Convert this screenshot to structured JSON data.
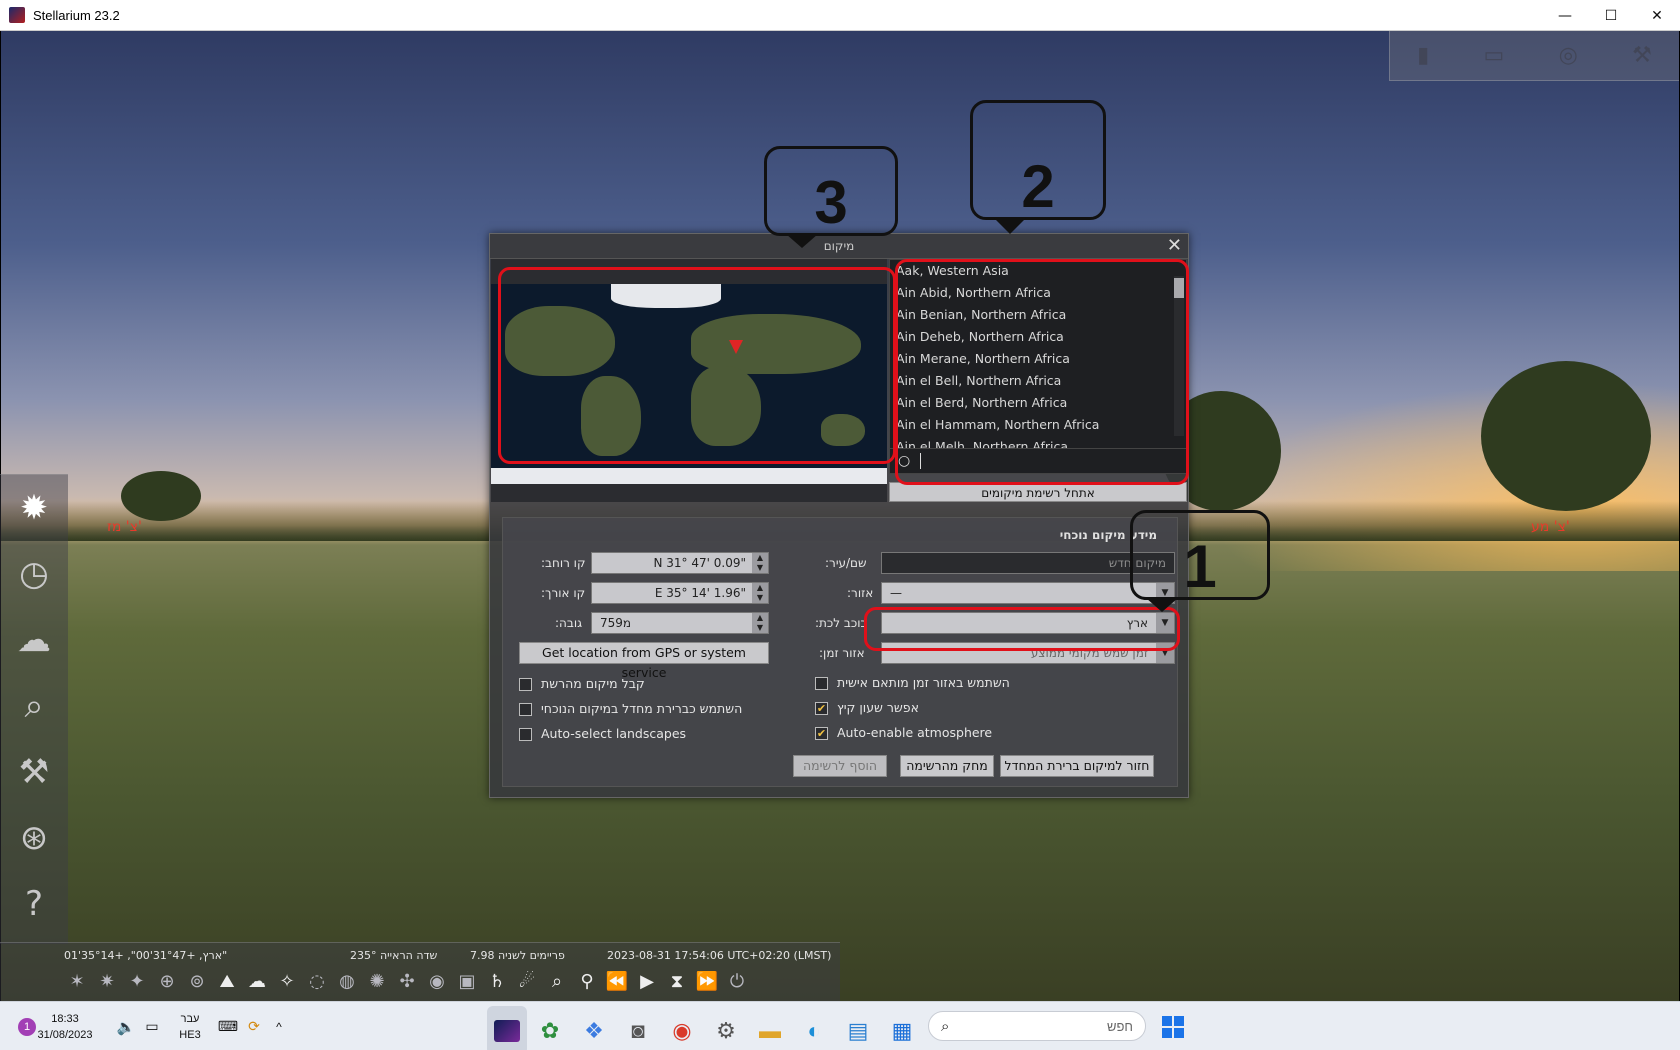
{
  "window": {
    "title": "Stellarium 23.2",
    "minimize": "—",
    "maximize": "☐",
    "close": "✕"
  },
  "scene": {
    "cardinal_left": "צ' מז'",
    "cardinal_right": "צ' מע'"
  },
  "dialog": {
    "title": "מיקום",
    "close": "✕",
    "city_list": [
      "Aak, Western Asia",
      "Ain Abid, Northern Africa",
      "Ain Benian, Northern Africa",
      "Ain Deheb, Northern Africa",
      "Ain Merane, Northern Africa",
      "Ain el Bell, Northern Africa",
      "Ain el Berd, Northern Africa",
      "Ain el Hammam, Northern Africa",
      "Ain el Melh, Northern Africa"
    ],
    "reset_list_button": "אתחל רשימת מיקומים",
    "section_title": "מידע מיקום נוכחי",
    "latitude_label": "קו רוחב:",
    "latitude_value": "N 31° 47' 0.09\"",
    "longitude_label": "קו אורך:",
    "longitude_value": "E 35° 14' 1.96\"",
    "altitude_label": "גובה:",
    "altitude_value": "759מ",
    "name_label": "שם/עיר:",
    "name_placeholder": "מיקום חדש",
    "region_label": "אזור:",
    "region_value": "—",
    "planet_label": "כוכב לכת:",
    "planet_value": "ארץ",
    "timezone_label": "אזור זמן:",
    "timezone_value": "זמן שמש מקומי ממוצע",
    "gps_button": "Get location from GPS or system service",
    "cb_network_location": "קבל מיקום מהרשת",
    "cb_use_default": "השתמש כברירת מחדל במיקום הנוכחי",
    "cb_auto_landscape": "Auto-select landscapes",
    "cb_custom_tz": "השתמש באזור זמן מותאם אישית",
    "cb_dst": "אפשר שעון קיץ",
    "cb_auto_atmosphere": "Auto-enable atmosphere",
    "add_button": "הוסף לרשימה",
    "delete_button": "מחק מהרשימה",
    "return_default_button": "חזור למיקום ברירת המחדל"
  },
  "annotations": {
    "bubble_1": "1",
    "bubble_2": "2",
    "bubble_3": "3"
  },
  "status": {
    "location": "ארץ, +31°47'00\", +35°14'01\"",
    "fov": "שדה הראייה 235°",
    "fps": "7.98 פריימים לשניה",
    "datetime": "2023-08-31 17:54:06 UTC+02:20 (LMST)"
  },
  "taskbar": {
    "time": "18:33",
    "date": "31/08/2023",
    "lang_top": "עבר",
    "lang_bottom": "HE3",
    "notification_count": "1",
    "search_placeholder": "חפש"
  },
  "colors": {
    "annotation_red": "#e0101a",
    "checkbox_check": "#f0c040",
    "pin": "#e02525"
  }
}
